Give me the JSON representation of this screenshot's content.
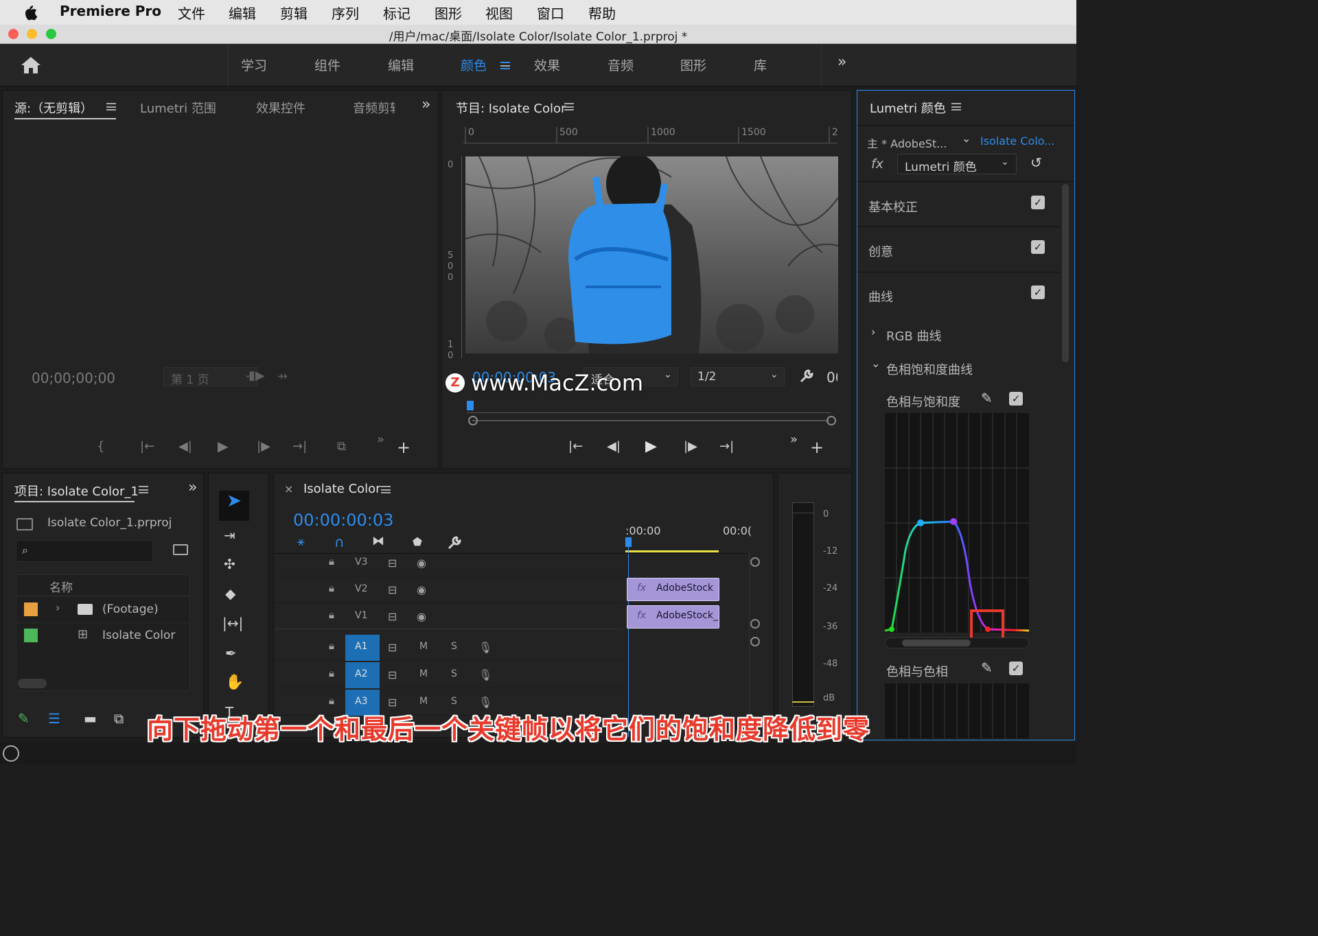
{
  "menubar": {
    "apple": "",
    "app": "Premiere Pro",
    "items": [
      "文件",
      "编辑",
      "剪辑",
      "序列",
      "标记",
      "图形",
      "视图",
      "窗口",
      "帮助"
    ]
  },
  "titlebar": {
    "path": "/用户/mac/桌面/Isolate Color/Isolate Color_1.prproj *"
  },
  "workspaces": {
    "tabs": [
      "学习",
      "组件",
      "编辑",
      "颜色",
      "效果",
      "音频",
      "图形",
      "库"
    ],
    "active": "颜色"
  },
  "source": {
    "tabs": [
      "源:（无剪辑）",
      "Lumetri 范围",
      "效果控件",
      "音频剪辑"
    ],
    "timecode": "00;00;00;00",
    "page": "第 1 页"
  },
  "program": {
    "title": "节目: Isolate Color",
    "ruler": [
      "0",
      "500",
      "1000",
      "1500",
      "2"
    ],
    "vruler_top": "0",
    "vruler_mid": "5\n0\n0",
    "vruler_bot": "1\n0",
    "timecode": "00:00:00:03",
    "fit": "适合",
    "res": "1/2",
    "tc_right": "00"
  },
  "watermark": "www.MacZ.com",
  "project": {
    "title": "项目: Isolate Color_1",
    "file": "Isolate Color_1.prproj",
    "col_name": "名称",
    "items": [
      {
        "name": "(Footage)",
        "color": "#e8a040"
      },
      {
        "name": "Isolate Color",
        "color": "#4cb85a"
      }
    ]
  },
  "timeline": {
    "title": "Isolate Color",
    "timecode": "00:00:00:03",
    "ruler": [
      ":00:00",
      "00:0("
    ],
    "tracks": [
      {
        "name": "V3"
      },
      {
        "name": "V2"
      },
      {
        "name": "V1"
      },
      {
        "name": "A1"
      },
      {
        "name": "A2"
      },
      {
        "name": "A3"
      }
    ],
    "clips": [
      "AdobeStock",
      "AdobeStock_"
    ],
    "mute": "M",
    "solo": "S"
  },
  "meter": {
    "ticks": [
      "0",
      "-12",
      "-24",
      "-36",
      "-48",
      "dB"
    ]
  },
  "lumetri": {
    "title": "Lumetri 颜色",
    "master": "主 * AdobeSt...",
    "clip": "Isolate Colo...",
    "effect": "Lumetri 颜色",
    "sections": [
      "基本校正",
      "创意",
      "曲线"
    ],
    "rgb_curve": "RGB 曲线",
    "hue_sat_curves": "色相饱和度曲线",
    "hue_vs_sat": "色相与饱和度",
    "hue_vs_hue": "色相与色相"
  },
  "caption": "向下拖动第一个和最后一个关键帧以将它们的饱和度降低到零",
  "colors": {
    "accent": "#2d8ceb",
    "highlight": "#e8392b",
    "caption": "#e8392b"
  }
}
